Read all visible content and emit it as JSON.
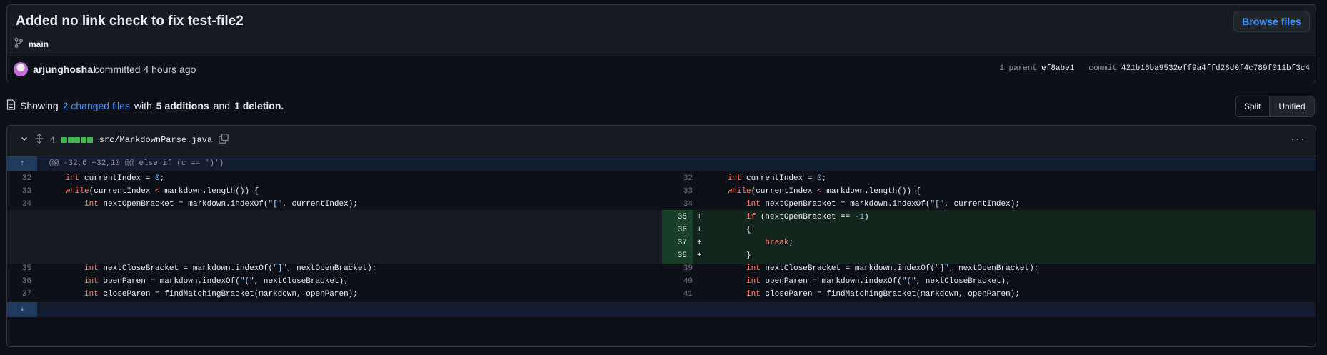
{
  "commit": {
    "title": "Added no link check to fix test-file2",
    "browse_label": "Browse files",
    "branch": "main",
    "author": "arjunghoshal",
    "committed_text": "committed 4 hours ago",
    "parent_label": "1 parent",
    "parent_sha": "ef8abe1",
    "commit_label": "commit",
    "commit_sha": "421b16ba9532eff9a4ffd28d0f4c789f011bf3c4"
  },
  "stats": {
    "showing": "Showing",
    "changed_files": "2 changed files",
    "with": "with",
    "additions": "5 additions",
    "and": "and",
    "deletions": "1 deletion."
  },
  "view_toggle": {
    "split": "Split",
    "unified": "Unified",
    "selected": "Unified"
  },
  "file": {
    "change_count": "4",
    "path": "src/MarkdownParse.java",
    "hunk_header": "@@ -32,6 +32,10 @@ else if (c == ')')",
    "context_before": [
      {
        "ln_left": "32",
        "ln_right": "32",
        "code": "int currentIndex = 0;"
      },
      {
        "ln_left": "33",
        "ln_right": "33",
        "code": "while(currentIndex < markdown.length()) {"
      },
      {
        "ln_left": "34",
        "ln_right": "34",
        "code": "int nextOpenBracket = markdown.indexOf(\"[\", currentIndex);"
      }
    ],
    "added": [
      {
        "ln": "35",
        "code": "if (nextOpenBracket == -1)"
      },
      {
        "ln": "36",
        "code": "{"
      },
      {
        "ln": "37",
        "code": "break;"
      },
      {
        "ln": "38",
        "code": "}"
      }
    ],
    "context_after": [
      {
        "ln_left": "35",
        "ln_right": "39",
        "code": "int nextCloseBracket = markdown.indexOf(\"]\", nextOpenBracket);"
      },
      {
        "ln_left": "36",
        "ln_right": "40",
        "code": "int openParen = markdown.indexOf(\"(\", nextCloseBracket);"
      },
      {
        "ln_left": "37",
        "ln_right": "41",
        "code": "int closeParen = findMatchingBracket(markdown, openParen);"
      }
    ]
  }
}
